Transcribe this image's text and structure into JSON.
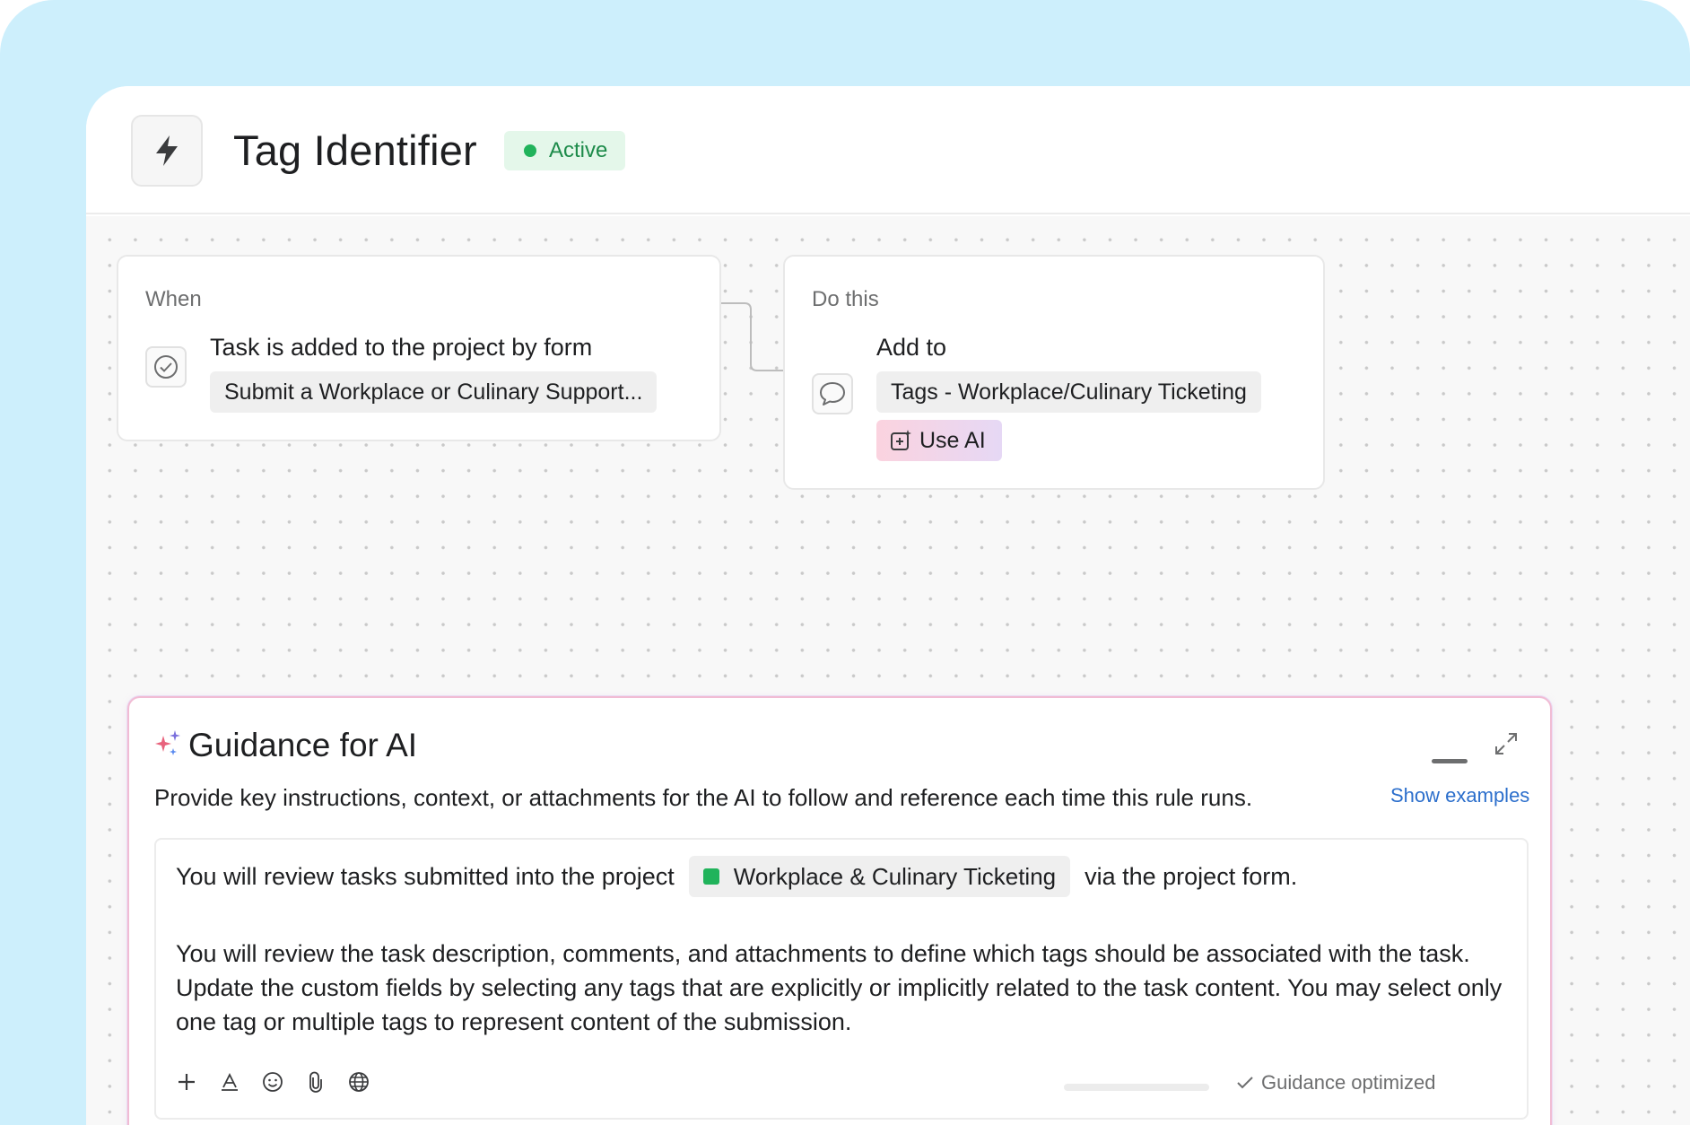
{
  "header": {
    "title": "Tag Identifier",
    "status": "Active",
    "icon": "lightning-bolt-icon"
  },
  "when_card": {
    "label": "When",
    "trigger": "Task is added to the project by form",
    "form_name": "Submit a Workplace or Culinary Support..."
  },
  "do_card": {
    "label": "Do this",
    "action": "Add to",
    "target": "Tags - Workplace/Culinary Ticketing",
    "ai_button": "Use AI"
  },
  "guidance": {
    "title": "Guidance for AI",
    "description": "Provide key instructions, context, or attachments for the AI to follow and reference each time this rule runs.",
    "show_examples": "Show examples",
    "line1_before": "You will review tasks submitted into the project",
    "project_chip": "Workplace & Culinary Ticketing",
    "line1_after": "via the project form.",
    "paragraph": "You will review the task description, comments, and attachments to define which tags should be associated with the task. Update the custom fields by selecting any tags that are explicitly or implicitly related to the task content. You may select only one tag or multiple tags to represent content of the submission.",
    "optimized_label": "Guidance optimized",
    "toolbar_icons": [
      "plus-icon",
      "text-format-icon",
      "emoji-icon",
      "attachment-icon",
      "globe-icon"
    ]
  },
  "colors": {
    "background": "#cdeffc",
    "active_green": "#21b35b",
    "link_blue": "#2c6fcc",
    "guidance_border": "#f1bcd4"
  }
}
